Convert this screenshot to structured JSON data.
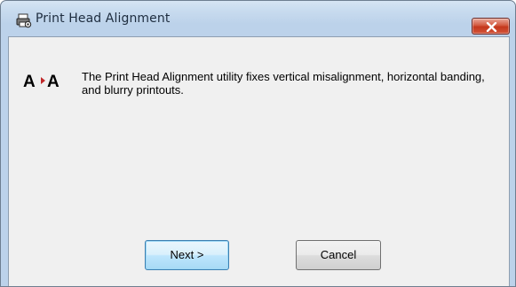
{
  "window": {
    "title": "Print Head Alignment",
    "icons": {
      "title_icon": "printer-gear-icon",
      "close_icon": "close-icon",
      "alignment_icon": "a-arrow-a-icon"
    },
    "colors": {
      "title_bar": "#bcd2ea",
      "client_background": "#f0f0f0",
      "close_button": "#c4371c"
    }
  },
  "content": {
    "message": "The Print Head Alignment utility fixes vertical misalignment, horizontal banding, and blurry printouts."
  },
  "buttons": {
    "next_label": "Next >",
    "cancel_label": "Cancel"
  }
}
